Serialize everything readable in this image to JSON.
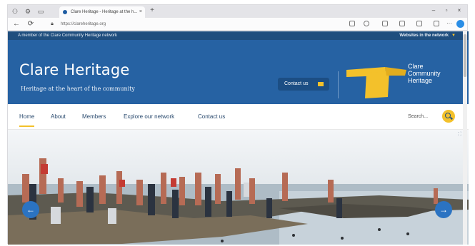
{
  "browser": {
    "tab_title": "Clare Heritage - Heritage at the h...",
    "tab_close": "×",
    "new_tab": "+",
    "url": "https://clareheritage.org",
    "back": "←",
    "refresh": "⟳",
    "window_controls": [
      "–",
      "▫",
      "×"
    ]
  },
  "site": {
    "topbar_left": "A member of the Clare Community Heritage network",
    "topbar_right": "Websites in the network",
    "title": "Clare Heritage",
    "tagline": "Heritage at the heart of the community",
    "contact_button": "Contact us",
    "logo_lines": [
      "Clare",
      "Community",
      "Heritage"
    ],
    "nav": [
      {
        "label": "Home",
        "active": true
      },
      {
        "label": "About",
        "active": false
      },
      {
        "label": "Members",
        "active": false
      },
      {
        "label": "Explore our network",
        "active": false
      },
      {
        "label": "Contact us",
        "active": false
      }
    ],
    "search_placeholder": "Search...",
    "hero_prev": "←",
    "hero_next": "→",
    "hero_fullscreen": "⛶"
  },
  "colors": {
    "brand_blue": "#2662a3",
    "dark_blue": "#1f4e7e",
    "accent_yellow": "#f3c12b"
  },
  "icons": [
    "back-icon",
    "refresh-icon",
    "lock-icon",
    "star-icon",
    "mail-icon",
    "search-icon",
    "arrow-left-icon",
    "arrow-right-icon",
    "fullscreen-icon"
  ]
}
